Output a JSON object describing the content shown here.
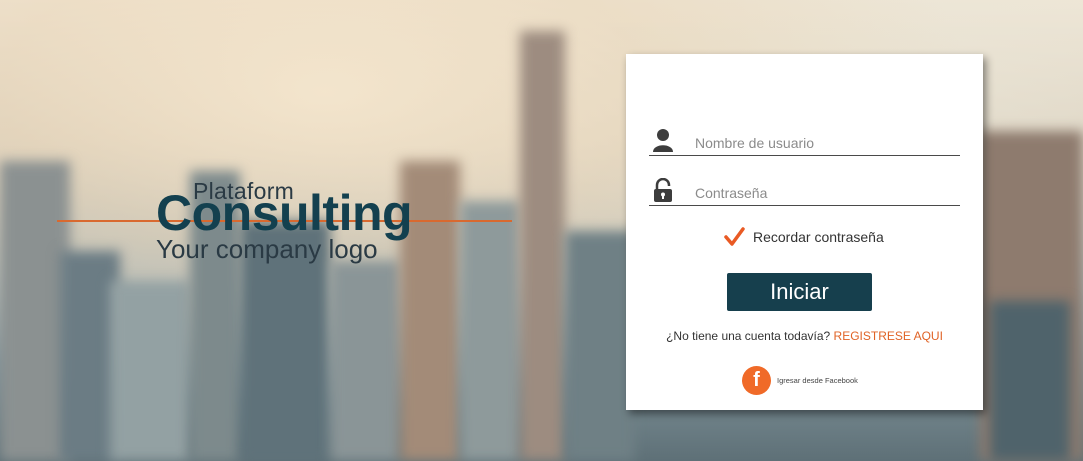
{
  "branding": {
    "line1": "Plataform",
    "line2": "Consulting",
    "line3": "Your company logo"
  },
  "login": {
    "username_placeholder": "Nombre de usuario",
    "username_value": "",
    "password_placeholder": "Contraseña",
    "password_value": "",
    "remember_label": "Recordar contraseña",
    "remember_checked": true,
    "submit_label": "Iniciar",
    "register_prompt": "¿No tiene una cuenta todavía?",
    "register_link": "REGISTRESE AQUI",
    "facebook_letter": "f",
    "facebook_label": "Igresar desde Facebook"
  },
  "icons": {
    "username": "user-icon",
    "password": "lock-icon",
    "remember": "checkmark-icon",
    "facebook": "facebook-icon"
  },
  "colors": {
    "accent": "#e06326",
    "button": "#163f4d",
    "brand_text": "#13404f",
    "facebook_circle": "#f06a28"
  }
}
